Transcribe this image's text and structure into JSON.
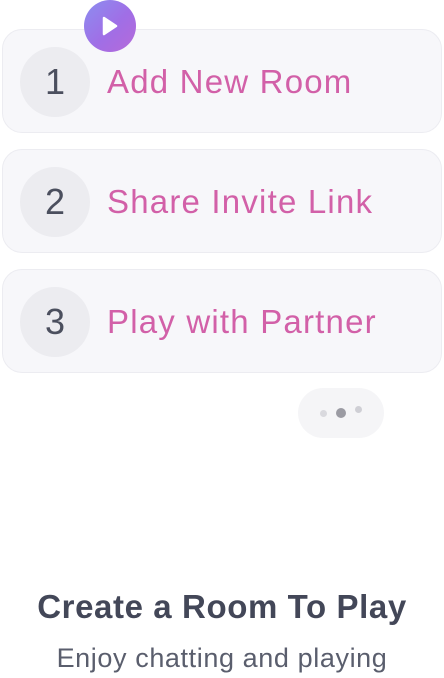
{
  "play_button": {
    "icon": "play-icon",
    "color_start": "#8c8ef0",
    "color_end": "#b66ad9"
  },
  "steps": [
    {
      "number": "1",
      "label": "Add New Room"
    },
    {
      "number": "2",
      "label": "Share Invite Link"
    },
    {
      "number": "3",
      "label": "Play with Partner"
    }
  ],
  "typing_indicator": {
    "icon": "typing-dots-icon"
  },
  "footer": {
    "title": "Create a Room To Play",
    "subtitle": "Enjoy chatting and playing"
  },
  "colors": {
    "accent_text": "#d260a8",
    "card_background": "#f7f7fa",
    "title_text": "#434758"
  }
}
